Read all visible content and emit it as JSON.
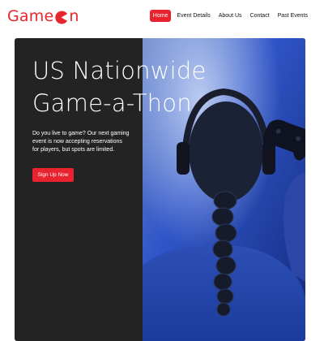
{
  "header": {
    "logo_text_left": "Game",
    "logo_text_right": "n",
    "logo_icon": "pacman-o-icon",
    "nav": [
      {
        "label": "Home",
        "active": true
      },
      {
        "label": "Event Details",
        "active": false
      },
      {
        "label": "About Us",
        "active": false
      },
      {
        "label": "Contact",
        "active": false
      },
      {
        "label": "Past Events",
        "active": false
      }
    ]
  },
  "hero": {
    "title_line1": "US Nationwide",
    "title_line2": "Game-a-Thon",
    "description_line1": "Do you live to game? Our next gaming",
    "description_line2": "event is now accepting reservations",
    "description_line3": "for players, but spots are limited.",
    "cta_label": "Sign Up Now",
    "image_icon": "gamer-with-controller-image"
  },
  "colors": {
    "brand": "#e8262e",
    "hero_bg": "#232323",
    "text_light": "#ffffff"
  }
}
